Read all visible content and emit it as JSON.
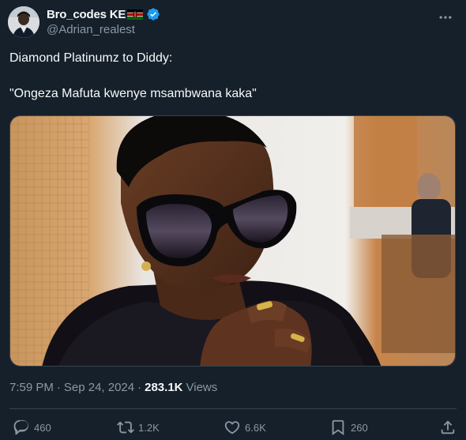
{
  "author": {
    "display_name": "Bro_codes KE",
    "handle": "@Adrian_realest",
    "flag_icon": "kenya-flag-icon",
    "verified_icon": "verified-badge-icon",
    "verified_color": "#1d9bf0"
  },
  "tweet": {
    "line1": "Diamond Platinumz to Diddy:",
    "line2": "\"Ongeza Mafuta kwenye msambwana kaka\""
  },
  "meta": {
    "time": "7:59 PM",
    "separator": "·",
    "date": "Sep 24, 2024",
    "views_count": "283.1K",
    "views_label": "Views"
  },
  "actions": {
    "replies": "460",
    "retweets": "1.2K",
    "likes": "6.6K",
    "bookmarks": "260"
  },
  "colors": {
    "background": "#15202b",
    "text_primary": "#f7f9f9",
    "text_secondary": "#8b98a5",
    "border": "#38444d"
  }
}
